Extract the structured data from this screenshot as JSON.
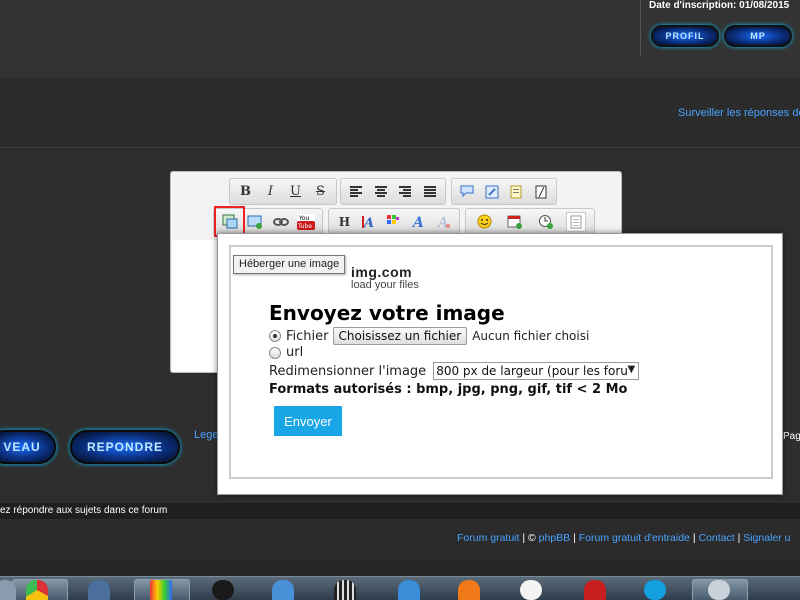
{
  "header": {
    "registration_date": "Date d'inscription: 01/08/2015",
    "profile_button": "PROFIL",
    "mp_button": "MP"
  },
  "topic": {
    "watch_link": "Surveiller les réponses de"
  },
  "editor": {
    "toolbar_row1": [
      {
        "name": "bold-icon",
        "glyph": "B"
      },
      {
        "name": "italic-icon",
        "glyph": "I"
      },
      {
        "name": "underline-icon",
        "glyph": "U"
      },
      {
        "name": "strikethrough-icon",
        "glyph": "S"
      }
    ],
    "toolbar_row2_text": [
      {
        "name": "heading-icon",
        "glyph": "H"
      }
    ]
  },
  "tooltip": {
    "text": "Héberger une image"
  },
  "upload_popup": {
    "logo_main": "img.com",
    "logo_sub": "load your files",
    "title": "Envoyez votre image",
    "file_option_label": "Fichier",
    "file_button_label": "Choisissez un fichier",
    "no_file_text": "Aucun fichier choisi",
    "url_option_label": "url",
    "resize_label": "Redimensionner l'image",
    "resize_selected": "800 px de largeur (pour les foru",
    "formats_text": "Formats autorisés : bmp, jpg, png, gif, tif < 2 Mo",
    "send_button": "Envoyer",
    "selected_option": "Fichier"
  },
  "actions": {
    "new_topic_button": "VEAU",
    "reply_button": "REPONDRE",
    "legend_link": "Lege",
    "pagination_text": "Pag"
  },
  "permissions": {
    "text": "ez répondre aux sujets dans ce forum"
  },
  "footer": {
    "link_forum_gratuit": "Forum gratuit",
    "separator1": " | © ",
    "link_phpbb": "phpBB",
    "separator2": " | ",
    "link_entraide": "Forum gratuit d'entraide",
    "separator3": " | ",
    "link_contact": "Contact",
    "separator4": " | ",
    "link_signaler": "Signaler u"
  },
  "colors": {
    "link": "#4aa3ff",
    "send_button": "#18a6e7",
    "highlight": "#e22222"
  },
  "taskbar": {
    "items": [
      "explorer-icon",
      "chrome-icon",
      "network-icon",
      "colorful-app-icon",
      "media-player-icon",
      "thunderbird-icon",
      "film-icon",
      "telegram-icon",
      "avast-icon",
      "juventus-icon",
      "acrobat-icon",
      "skype-icon",
      "speaker-app-icon"
    ]
  }
}
